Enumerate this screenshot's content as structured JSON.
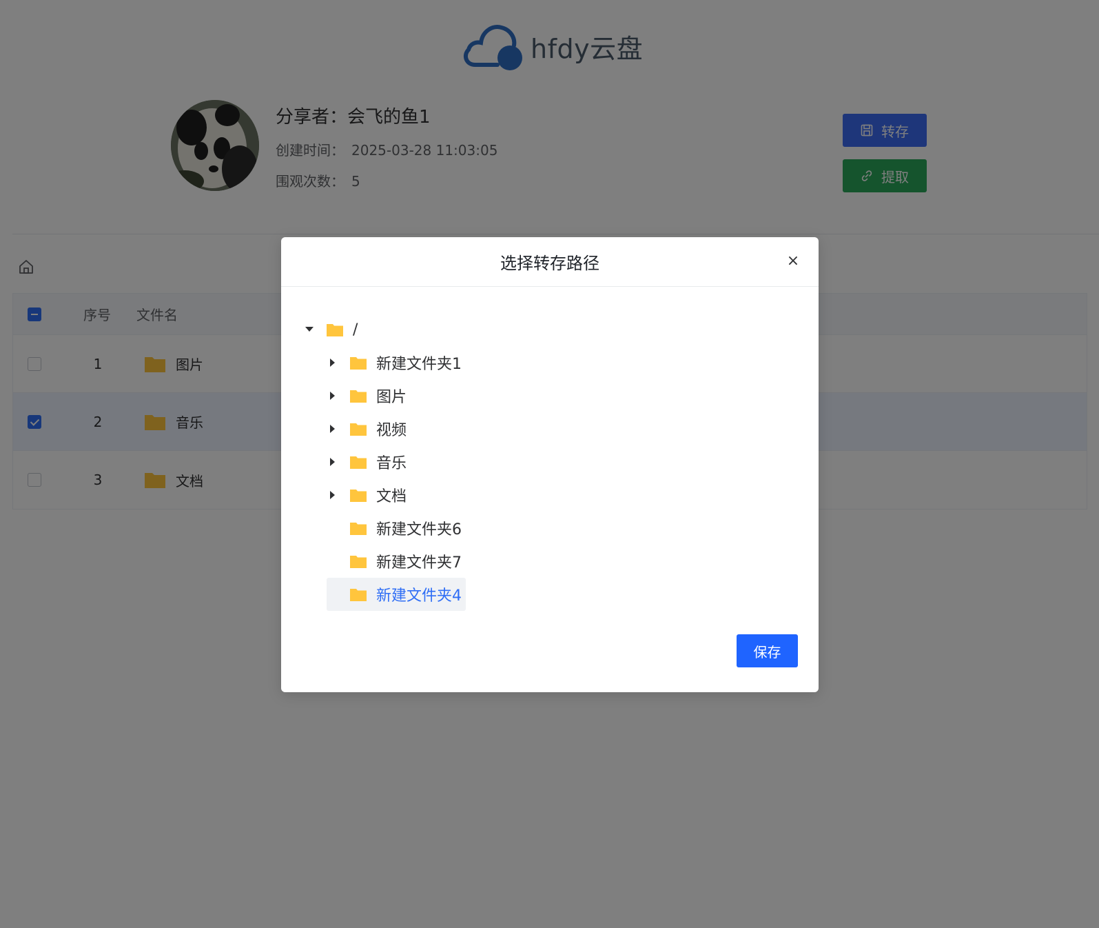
{
  "app": {
    "logo_text": "hfdy云盘"
  },
  "share": {
    "sharer": "分享者：会飞的鱼1",
    "created_label": "创建时间：",
    "created_value": "2025-03-28 11:03:05",
    "views_label": "围观次数：",
    "views_value": "5"
  },
  "actions": {
    "save_label": "转存",
    "extract_label": "提取"
  },
  "table": {
    "headers": {
      "index": "序号",
      "name": "文件名"
    },
    "rows": [
      {
        "index": "1",
        "name": "图片",
        "checked": false
      },
      {
        "index": "2",
        "name": "音乐",
        "checked": true
      },
      {
        "index": "3",
        "name": "文档",
        "checked": false
      }
    ]
  },
  "modal": {
    "title": "选择转存路径",
    "close_glyph": "×",
    "save_label": "保存",
    "tree": {
      "root": "/",
      "children": [
        "新建文件夹1",
        "图片",
        "视频",
        "音乐",
        "文档",
        "新建文件夹6",
        "新建文件夹7",
        "新建文件夹4"
      ],
      "current": "新建文件夹4"
    }
  },
  "colors": {
    "primary": "#1f64ff",
    "success": "#2aa95b",
    "folder": "#ffc53d",
    "logo": "#2f6ec5"
  }
}
